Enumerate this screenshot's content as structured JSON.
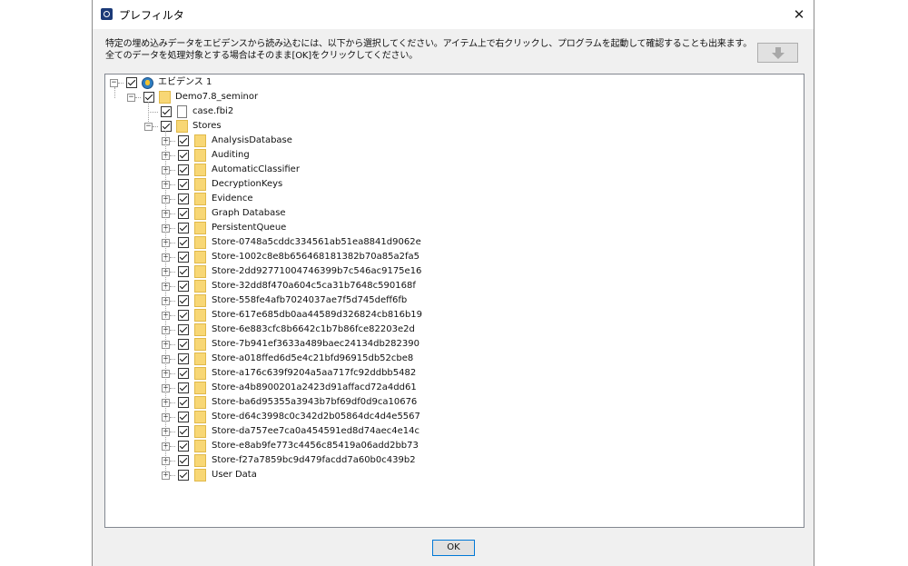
{
  "window": {
    "title": "プレフィルタ",
    "close_glyph": "✕",
    "close_icon": "close-icon",
    "app_icon": "app-icon"
  },
  "instructions": {
    "line1": "特定の埋め込みデータをエビデンスから読み込むには、以下から選択してください。アイテム上で右クリックし、プログラムを起動して確認することも出来ます。",
    "line2": "全てのデータを処理対象とする場合はそのまま[OK]をクリックしてください。"
  },
  "import_button": {
    "icon": "down-arrow-icon"
  },
  "tree": {
    "root": {
      "label": "エビデンス 1",
      "expanded": true,
      "checked": true,
      "icon": "evidence-icon"
    },
    "case_folder": {
      "label": "Demo7.8_seminor",
      "expanded": true,
      "checked": true,
      "icon": "folder-icon"
    },
    "case_file": {
      "label": "case.fbi2",
      "checked": true,
      "icon": "file-icon"
    },
    "stores": {
      "label": "Stores",
      "expanded": true,
      "checked": true,
      "icon": "folder-icon"
    },
    "store_items": [
      "AnalysisDatabase",
      "Auditing",
      "AutomaticClassifier",
      "DecryptionKeys",
      "Evidence",
      "Graph Database",
      "PersistentQueue",
      "Store-0748a5cddc334561ab51ea8841d9062e",
      "Store-1002c8e8b656468181382b70a85a2fa5",
      "Store-2dd92771004746399b7c546ac9175e16",
      "Store-32dd8f470a604c5ca31b7648c590168f",
      "Store-558fe4afb7024037ae7f5d745deff6fb",
      "Store-617e685db0aa44589d326824cb816b19",
      "Store-6e883cfc8b6642c1b7b86fce82203e2d",
      "Store-7b941ef3633a489baec24134db282390",
      "Store-a018ffed6d5e4c21bfd96915db52cbe8",
      "Store-a176c639f9204a5aa717fc92ddbb5482",
      "Store-a4b8900201a2423d91affacd72a4dd61",
      "Store-ba6d95355a3943b7bf69df0d9ca10676",
      "Store-d64c3998c0c342d2b05864dc4d4e5567",
      "Store-da757ee7ca0a454591ed8d74aec4e14c",
      "Store-e8ab9fe773c4456c85419a06add2bb73",
      "Store-f27a7859bc9d479facdd7a60b0c439b2",
      "User Data"
    ],
    "expand_glyph": "+",
    "collapse_glyph": "−"
  },
  "ok_button": {
    "label": "OK"
  }
}
